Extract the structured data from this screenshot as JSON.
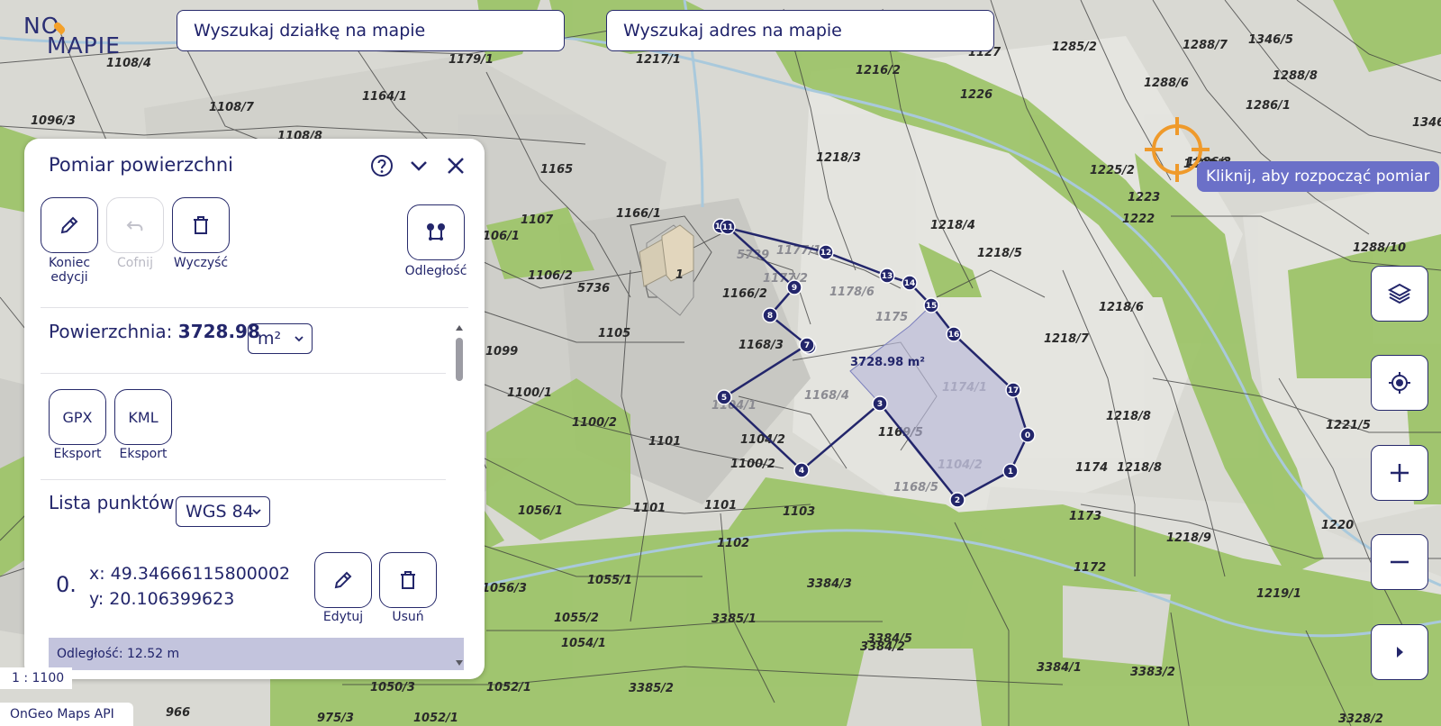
{
  "logo": {
    "line1": "NO",
    "line2": "MAPIE"
  },
  "search": {
    "parcel_placeholder": "Wyszukaj działkę na mapie",
    "address_placeholder": "Wyszukaj adres na mapie"
  },
  "panel": {
    "title": "Pomiar powierzchni",
    "icons": {
      "help": "help-circle-icon",
      "collapse": "chevron-down-icon",
      "close": "close-icon"
    },
    "tools": [
      {
        "label": "Koniec edycji",
        "icon": "pencil-icon",
        "enabled": true
      },
      {
        "label": "Cofnij",
        "icon": "undo-icon",
        "enabled": false
      },
      {
        "label": "Wyczyść",
        "icon": "trash-icon",
        "enabled": true
      }
    ],
    "distance_tool": {
      "label": "Odległość",
      "icon": "distance-points-icon"
    },
    "area_label": "Powierzchnia:",
    "area_value": "3728.98",
    "area_unit": "m²",
    "exports": [
      {
        "format": "GPX",
        "label": "Eksport"
      },
      {
        "format": "KML",
        "label": "Eksport"
      }
    ],
    "points_list_label": "Lista punktów",
    "crs": "WGS 84",
    "points": [
      {
        "index": "0.",
        "x": "x: 49.34666115800002",
        "y": "y: 20.106399623",
        "edit_label": "Edytuj",
        "delete_label": "Usuń",
        "distance": "Odległość: 12.52 m"
      }
    ]
  },
  "map": {
    "tooltip": "Kliknij, aby rozpocząć pomiar",
    "area_annotation": "3728.98 m²",
    "scale": "1 : 1100",
    "attribution": "OnGeo Maps API",
    "controls": [
      "layers-icon",
      "locate-icon",
      "zoom-in-icon",
      "zoom-out-icon",
      "expand-right-icon"
    ],
    "building_label": "1",
    "parcels": [
      "1108/4",
      "1179/1",
      "1217/1",
      "1216/2",
      "1127",
      "1285/2",
      "1288/7",
      "1346/5",
      "1164/1",
      "1108/7",
      "1096/3",
      "1108/8",
      "1226",
      "1288/6",
      "1286/1",
      "1288/8",
      "1346",
      "1218/3",
      "1165",
      "1225/2",
      "1286/2",
      "1288/9",
      "1223",
      "1107",
      "1166/1",
      "106/1",
      "1218/4",
      "1222",
      "1288/10",
      "1218/5",
      "5739",
      "1177/2",
      "1177/1",
      "1166/2",
      "1178/6",
      "1106/2",
      "5736",
      "1175",
      "1218/6",
      "1105",
      "1168/3",
      "1218/7",
      "1099",
      "1174/1",
      "1100/1",
      "1168/4",
      "1104/1",
      "1100/2",
      "1101",
      "1104/2",
      "1168/5",
      "1218/8",
      "1221/5",
      "1100/2",
      "1104/2",
      "1174",
      "1218/8",
      "1056/1",
      "1101",
      "1101",
      "1103",
      "1173",
      "1220",
      "1102",
      "1218/9",
      "1172",
      "1055/1",
      "3384/3",
      "1056/3",
      "1219/1",
      "1055/2",
      "3385/1",
      "1054/1",
      "3384/5",
      "3384/2",
      "3384/1",
      "3383/2",
      "1050/3",
      "1052/1",
      "3385/2",
      "966",
      "975/3",
      "1052/1",
      "3328/2",
      "1169/5"
    ],
    "vertex_labels": [
      "0",
      "1",
      "2",
      "3",
      "4",
      "5",
      "6",
      "7",
      "8",
      "9",
      "10",
      "11",
      "12",
      "13",
      "14",
      "15",
      "16",
      "17"
    ]
  }
}
